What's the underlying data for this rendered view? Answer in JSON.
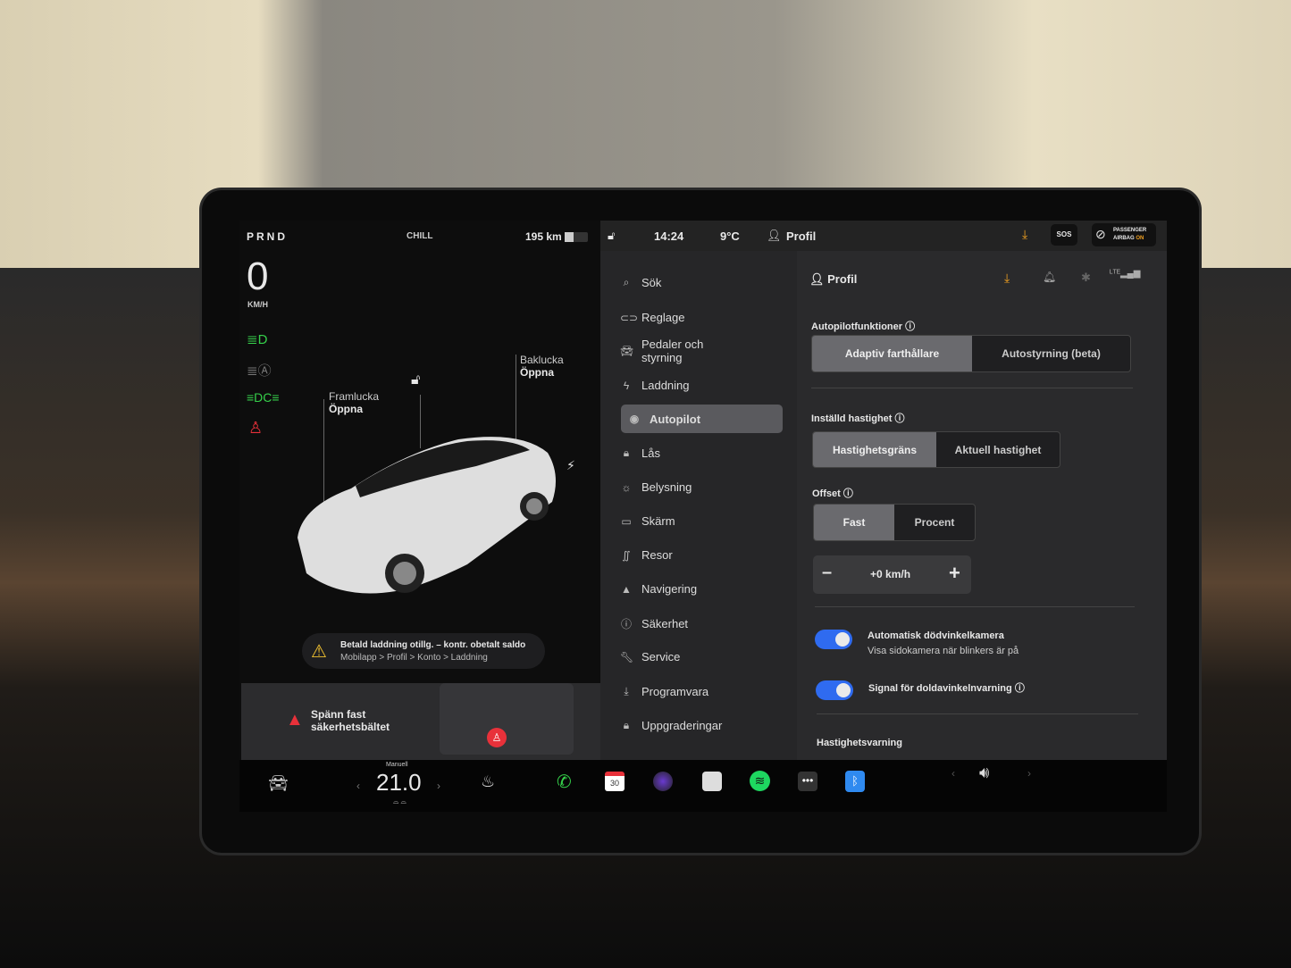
{
  "status": {
    "gear": "PRND",
    "mode": "CHILL",
    "range": "195 km",
    "speed": "0",
    "speed_unit": "KM/H"
  },
  "topbar": {
    "time": "14:24",
    "temp": "9°C",
    "profile": "Profil",
    "sos": "SOS",
    "airbag_line1": "PASSENGER",
    "airbag_line2": "AIRBAG",
    "airbag_state": "ON"
  },
  "car": {
    "frunk_label": "Framlucka",
    "frunk_action": "Öppna",
    "trunk_label": "Baklucka",
    "trunk_action": "Öppna"
  },
  "alerts": {
    "charging_title": "Betald laddning otillg. – kontr. obetalt saldo",
    "charging_path": "Mobilapp > Profil > Konto > Laddning",
    "seatbelt_line1": "Spänn fast",
    "seatbelt_line2": "säkerhetsbältet"
  },
  "menu": {
    "items": [
      {
        "label": "Sök",
        "icon": "search-icon"
      },
      {
        "label": "Reglage",
        "icon": "toggle-icon"
      },
      {
        "label": "Pedaler och styrning",
        "icon": "car-icon"
      },
      {
        "label": "Laddning",
        "icon": "bolt-icon"
      },
      {
        "label": "Autopilot",
        "icon": "steering-wheel-icon",
        "active": true
      },
      {
        "label": "Lås",
        "icon": "lock-icon"
      },
      {
        "label": "Belysning",
        "icon": "sun-icon"
      },
      {
        "label": "Skärm",
        "icon": "display-icon"
      },
      {
        "label": "Resor",
        "icon": "trips-icon"
      },
      {
        "label": "Navigering",
        "icon": "navigation-icon"
      },
      {
        "label": "Säkerhet",
        "icon": "safety-icon"
      },
      {
        "label": "Service",
        "icon": "wrench-icon"
      },
      {
        "label": "Programvara",
        "icon": "download-icon"
      },
      {
        "label": "Uppgraderingar",
        "icon": "shopping-bag-icon"
      }
    ]
  },
  "content": {
    "profile": "Profil",
    "autopilot_features": {
      "label": "Autopilotfunktioner",
      "options": [
        "Adaptiv farthållare",
        "Autostyrning (beta)"
      ],
      "selected": 0
    },
    "set_speed": {
      "label": "Inställd hastighet",
      "options": [
        "Hastighetsgräns",
        "Aktuell hastighet"
      ],
      "selected": 0
    },
    "offset": {
      "label": "Offset",
      "options": [
        "Fast",
        "Procent"
      ],
      "selected": 0,
      "value": "+0 km/h"
    },
    "blind_spot_camera": {
      "label": "Automatisk dödvinkelkamera",
      "sub": "Visa sidokamera när blinkers är på",
      "on": true
    },
    "blind_spot_chime": {
      "label": "Signal för doldavinkelnvarning",
      "on": true
    },
    "next_section": "Hastighetsvarning"
  },
  "bottom": {
    "climate_mode": "Manuell",
    "temperature": "21.0",
    "calendar_day": "30"
  },
  "colors": {
    "accent_blue": "#2f6bf0",
    "warning_orange": "#f0a020",
    "alert_red": "#e8313a",
    "indicator_green": "#35d04a"
  }
}
